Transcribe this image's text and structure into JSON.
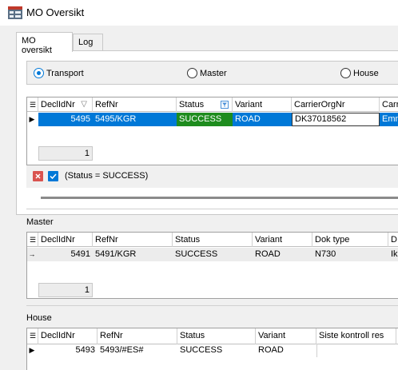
{
  "window": {
    "title": "MO Oversikt"
  },
  "tabs": [
    {
      "label": "MO oversikt",
      "active": true
    },
    {
      "label": "Log",
      "active": false
    }
  ],
  "mode_options": [
    {
      "label": "Transport",
      "checked": true
    },
    {
      "label": "Master",
      "checked": false
    },
    {
      "label": "House",
      "checked": false
    }
  ],
  "transport_grid": {
    "columns": [
      "DeclIdNr",
      "RefNr",
      "Status",
      "Variant",
      "CarrierOrgNr",
      "Carr"
    ],
    "rows": [
      {
        "DeclIdNr": "5495",
        "RefNr": "5495/KGR",
        "Status": "SUCCESS",
        "Variant": "ROAD",
        "CarrierOrgNr": "DK37018562",
        "Carr": "Emm"
      }
    ],
    "count": "1"
  },
  "filter": {
    "text": "(Status = SUCCESS)"
  },
  "master": {
    "label": "Master",
    "columns": [
      "DeclIdNr",
      "RefNr",
      "Status",
      "Variant",
      "Dok type",
      "D"
    ],
    "rows": [
      {
        "DeclIdNr": "5491",
        "RefNr": "5491/KGR",
        "Status": "SUCCESS",
        "Variant": "ROAD",
        "Dok type": "N730",
        "D": "Ik"
      }
    ],
    "count": "1"
  },
  "house": {
    "label": "House",
    "columns": [
      "DeclIdNr",
      "RefNr",
      "Status",
      "Variant",
      "Siste kontroll res"
    ],
    "rows": [
      {
        "DeclIdNr": "5493",
        "RefNr": "5493/#ES#",
        "Status": "SUCCESS",
        "Variant": "ROAD",
        "Siste kontroll res": ""
      }
    ]
  },
  "colors": {
    "selection": "#0078d7",
    "success_cell": "#1e8c1e",
    "accent": "#0078d7",
    "clear_red": "#d9534f"
  },
  "icons": {
    "app": "app-grid-icon",
    "sort": "sort-desc-icon",
    "filter": "filter-icon",
    "clear": "close-icon",
    "check": "checkbox-icon"
  }
}
